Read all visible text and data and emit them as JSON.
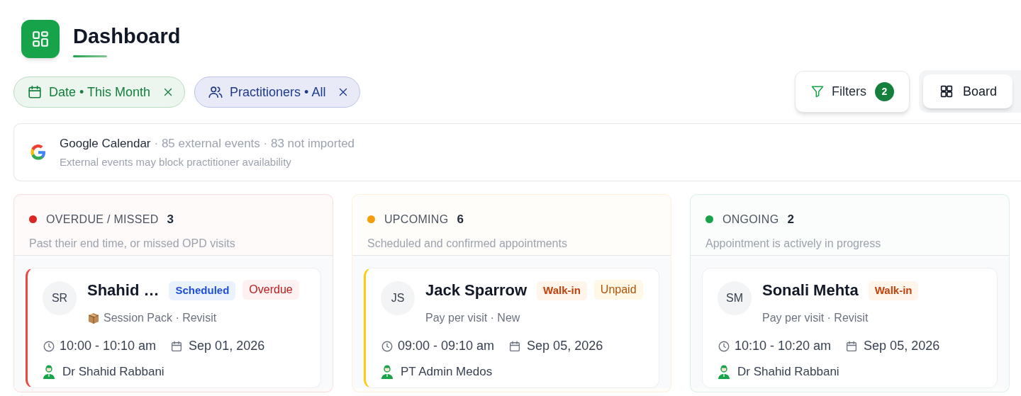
{
  "header": {
    "title": "Dashboard"
  },
  "chips": [
    {
      "kind": "date",
      "label": "Date • This Month"
    },
    {
      "kind": "people",
      "label": "Practitioners • All"
    }
  ],
  "filters_button": {
    "label": "Filters",
    "count": "2"
  },
  "view_button": {
    "label": "Board",
    "selected": true
  },
  "calendar_banner": {
    "source": "Google Calendar",
    "details": "· 85 external events · 83 not imported",
    "note": "External events may block practitioner availability"
  },
  "columns": [
    {
      "title": "OVERDUE / MISSED",
      "count": "3",
      "color": "#dc2626",
      "description": "Past their end time, or missed OPD visits",
      "cards": [
        {
          "kind": "package",
          "initials": "SR",
          "name": "Shahid …",
          "color": "#ef4444",
          "badges": [
            {
              "kind": "blue",
              "label": "Scheduled"
            },
            {
              "kind": "red",
              "label": "Overdue"
            }
          ],
          "subtitle": "Session Pack · Revisit",
          "time": "10:00 - 10:10 am",
          "date": "Sep 01, 2026",
          "practitioner": "Dr Shahid Rabbani"
        }
      ]
    },
    {
      "title": "UPCOMING",
      "count": "6",
      "color": "#f59e0b",
      "description": "Scheduled and confirmed appointments",
      "cards": [
        {
          "kind": "plain",
          "initials": "JS",
          "name": "Jack Sparrow",
          "color": "#facc15",
          "badges": [
            {
              "kind": "orange",
              "label": "Walk-in"
            },
            {
              "kind": "amber",
              "label": "Unpaid"
            }
          ],
          "subtitle": "Pay per visit · New",
          "time": "09:00 - 09:10 am",
          "date": "Sep 05, 2026",
          "practitioner": "PT Admin Medos"
        }
      ]
    },
    {
      "title": "ONGOING",
      "count": "2",
      "color": "#16a34a",
      "description": "Appointment is actively in progress",
      "cards": [
        {
          "kind": "plain",
          "initials": "SM",
          "name": "Sonali Mehta",
          "badges": [
            {
              "kind": "orange",
              "label": "Walk-in"
            }
          ],
          "subtitle": "Pay per visit · Revisit",
          "time": "10:10 - 10:20 am",
          "date": "Sep 05, 2026",
          "practitioner": "Dr Shahid Rabbani"
        }
      ]
    }
  ]
}
